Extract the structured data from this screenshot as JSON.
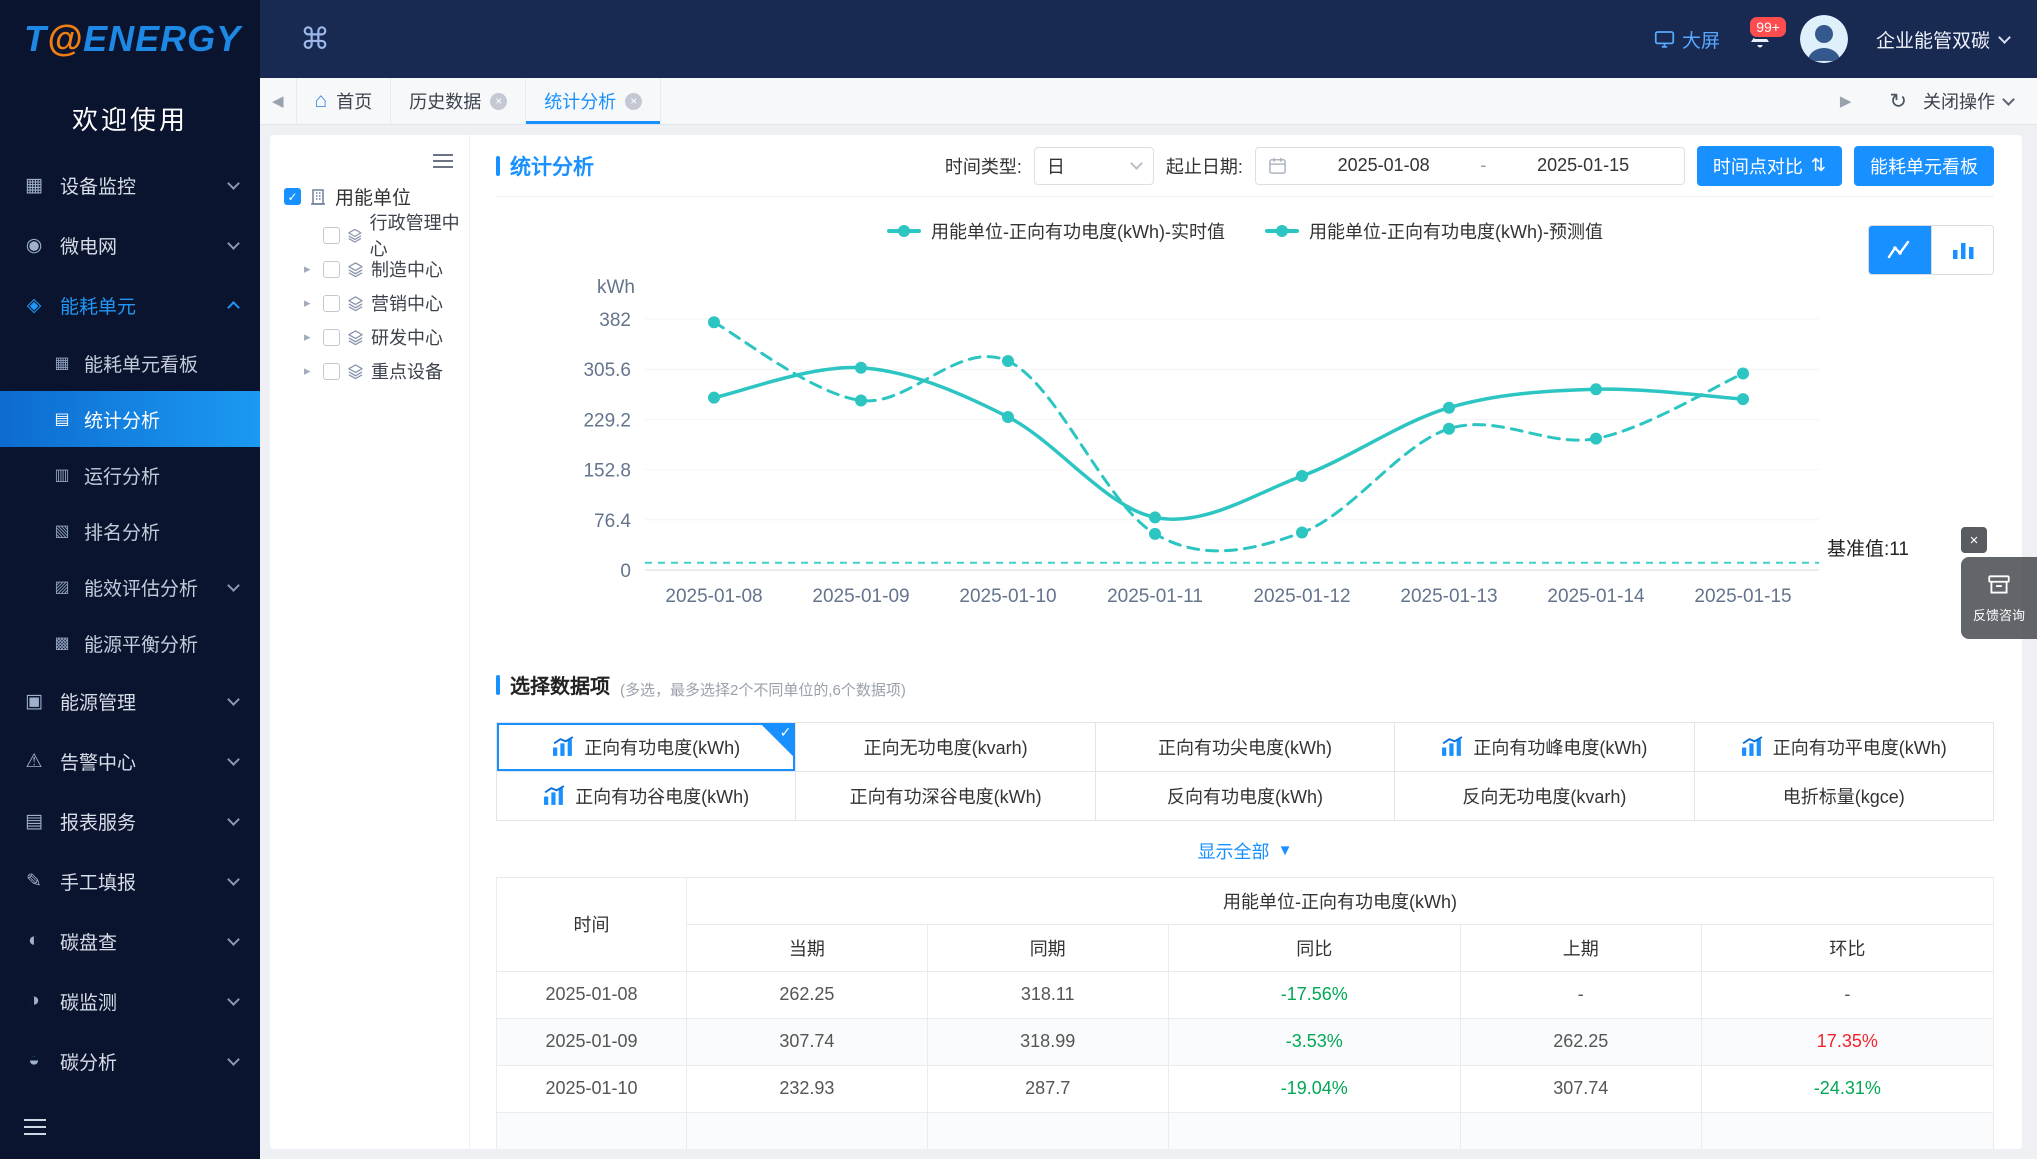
{
  "colors": {
    "primary": "#1890ff",
    "teal": "#2cc5c2",
    "green": "#00a854",
    "red": "#f5222d"
  },
  "topbar": {
    "logo_t": "T",
    "logo_at": "@",
    "logo_rest": "ENERGY",
    "command_icon": "command",
    "big_screen": "大屏",
    "notif_badge": "99+",
    "org_switcher": "企业能管双碳"
  },
  "sidebar": {
    "welcome": "欢迎使用",
    "items": [
      {
        "label": "设备监控",
        "icon": "monitor",
        "expandable": true
      },
      {
        "label": "微电网",
        "icon": "microgrid",
        "expandable": true
      },
      {
        "label": "能耗单元",
        "icon": "energy-unit",
        "expandable": true,
        "active": true,
        "expanded": true,
        "children": [
          {
            "label": "能耗单元看板",
            "icon": "kanban"
          },
          {
            "label": "统计分析",
            "icon": "stats",
            "active": true
          },
          {
            "label": "运行分析",
            "icon": "run"
          },
          {
            "label": "排名分析",
            "icon": "rank"
          },
          {
            "label": "能效评估分析",
            "icon": "evaluate",
            "expandable": true
          },
          {
            "label": "能源平衡分析",
            "icon": "balance"
          }
        ]
      },
      {
        "label": "能源管理",
        "icon": "manage",
        "expandable": true
      },
      {
        "label": "告警中心",
        "icon": "alarm",
        "expandable": true
      },
      {
        "label": "报表服务",
        "icon": "report",
        "expandable": true
      },
      {
        "label": "手工填报",
        "icon": "fill",
        "expandable": true
      },
      {
        "label": "碳盘查",
        "icon": "carbon-check",
        "expandable": true
      },
      {
        "label": "碳监测",
        "icon": "carbon-monitor",
        "expandable": true
      },
      {
        "label": "碳分析",
        "icon": "carbon-analysis",
        "expandable": true
      }
    ]
  },
  "tabbar": {
    "tabs": [
      {
        "label": "首页",
        "home_icon": true,
        "closable": false
      },
      {
        "label": "历史数据",
        "closable": true
      },
      {
        "label": "统计分析",
        "closable": true,
        "active": true
      }
    ],
    "close_ops": "关闭操作"
  },
  "tree": {
    "root_label": "用能单位",
    "children": [
      {
        "label": "行政管理中心",
        "expandable": false
      },
      {
        "label": "制造中心",
        "expandable": true
      },
      {
        "label": "营销中心",
        "expandable": true
      },
      {
        "label": "研发中心",
        "expandable": true
      },
      {
        "label": "重点设备",
        "expandable": true
      }
    ]
  },
  "filters": {
    "title": "统计分析",
    "time_type_label": "时间类型:",
    "time_type_value": "日",
    "date_range_label": "起止日期:",
    "date_start": "2025-01-08",
    "date_sep": "-",
    "date_end": "2025-01-15",
    "compare_btn": "时间点对比",
    "board_btn": "能耗单元看板"
  },
  "chart_data": {
    "type": "line",
    "unit": "kWh",
    "x": [
      "2025-01-08",
      "2025-01-09",
      "2025-01-10",
      "2025-01-11",
      "2025-01-12",
      "2025-01-13",
      "2025-01-14",
      "2025-01-15"
    ],
    "series": [
      {
        "name": "用能单位-正向有功电度(kWh)-实时值",
        "style": "solid",
        "values": [
          262.25,
          307.74,
          232.93,
          80,
          143,
          247,
          275,
          260
        ]
      },
      {
        "name": "用能单位-正向有功电度(kWh)-预测值",
        "style": "dashed",
        "values": [
          377,
          258,
          318,
          55,
          57,
          215,
          200,
          299
        ]
      }
    ],
    "yticks": [
      0,
      76.4,
      152.8,
      229.2,
      305.6,
      382
    ],
    "ylim": [
      0,
      382
    ],
    "grid": false,
    "legend_position": "top",
    "baseline": {
      "value": 11,
      "label": "基准值:11"
    }
  },
  "data_picker": {
    "heading": "选择数据项",
    "note": "(多选，最多选择2个不同单位的,6个数据项)",
    "show_all": "显示全部",
    "items": [
      {
        "label": "正向有功电度(kWh)",
        "selected": true,
        "has_icon": true
      },
      {
        "label": "正向无功电度(kvarh)",
        "selected": false,
        "has_icon": false
      },
      {
        "label": "正向有功尖电度(kWh)",
        "selected": false,
        "has_icon": false
      },
      {
        "label": "正向有功峰电度(kWh)",
        "selected": false,
        "has_icon": true
      },
      {
        "label": "正向有功平电度(kWh)",
        "selected": false,
        "has_icon": true
      },
      {
        "label": "正向有功谷电度(kWh)",
        "selected": false,
        "has_icon": true
      },
      {
        "label": "正向有功深谷电度(kWh)",
        "selected": false,
        "has_icon": false
      },
      {
        "label": "反向有功电度(kWh)",
        "selected": false,
        "has_icon": false
      },
      {
        "label": "反向无功电度(kvarh)",
        "selected": false,
        "has_icon": false
      },
      {
        "label": "电折标量(kgce)",
        "selected": false,
        "has_icon": false
      }
    ]
  },
  "table": {
    "time_header": "时间",
    "group_header": "用能单位-正向有功电度(kWh)",
    "sub_headers": [
      "当期",
      "同期",
      "同比",
      "上期",
      "环比"
    ],
    "rows": [
      {
        "time": "2025-01-08",
        "cells": [
          "262.25",
          "318.11",
          "-17.56%",
          "-",
          "-"
        ]
      },
      {
        "time": "2025-01-09",
        "cells": [
          "307.74",
          "318.99",
          "-3.53%",
          "262.25",
          "17.35%"
        ]
      },
      {
        "time": "2025-01-10",
        "cells": [
          "232.93",
          "287.7",
          "-19.04%",
          "307.74",
          "-24.31%"
        ]
      }
    ]
  },
  "feedback": {
    "label": "反馈咨询"
  }
}
